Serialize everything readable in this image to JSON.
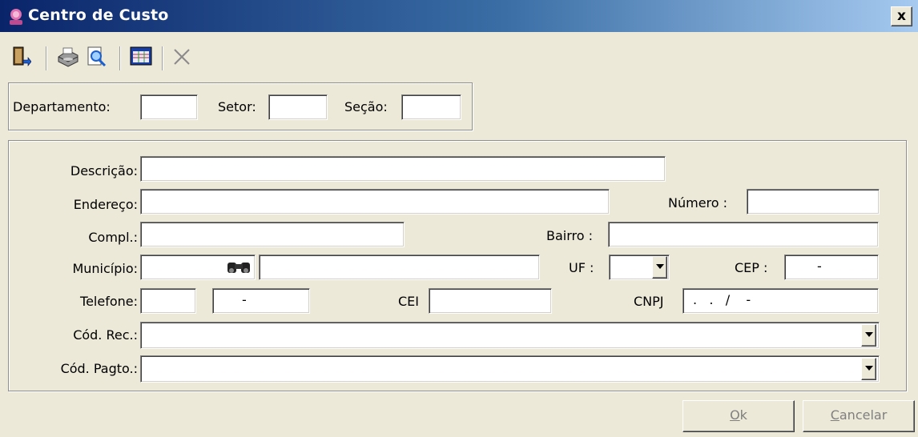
{
  "window": {
    "title": "Centro de Custo",
    "close_glyph": "x"
  },
  "toolbar": {
    "icons": [
      "exit-door-icon",
      "printer-icon",
      "print-preview-icon",
      "grid-table-icon",
      "delete-x-icon"
    ]
  },
  "top_group": {
    "departamento_label": "Departamento:",
    "departamento_value": "",
    "setor_label": "Setor:",
    "setor_value": "",
    "secao_label": "Seção:",
    "secao_value": ""
  },
  "form": {
    "descricao_label": "Descrição:",
    "descricao_value": "",
    "endereco_label": "Endereço:",
    "endereco_value": "",
    "numero_label": "Número :",
    "numero_value": "",
    "compl_label": "Compl.:",
    "compl_value": "",
    "bairro_label": "Bairro :",
    "bairro_value": "",
    "municipio_label": "Município:",
    "municipio_code": "",
    "municipio_name": "",
    "uf_label": "UF :",
    "uf_value": "",
    "cep_label": "CEP :",
    "cep_mask": "-",
    "telefone_label": "Telefone:",
    "ddd_value": "",
    "telefone_mask": "-",
    "cei_label": "CEI",
    "cei_value": "",
    "cnpj_label": "CNPJ",
    "cnpj_mask": ".   .   /    -",
    "cod_rec_label": "Cód. Rec.:",
    "cod_rec_value": "",
    "cod_pagto_label": "Cód. Pagto.:",
    "cod_pagto_value": ""
  },
  "buttons": {
    "ok_mnemonic": "O",
    "ok_rest": "k",
    "cancel_mnemonic": "C",
    "cancel_rest": "ancelar"
  },
  "colors": {
    "title_gradient_start": "#0a246a",
    "title_gradient_end": "#a6caf0",
    "face": "#ece9d8",
    "disabled_text": "#7f7f7f"
  }
}
